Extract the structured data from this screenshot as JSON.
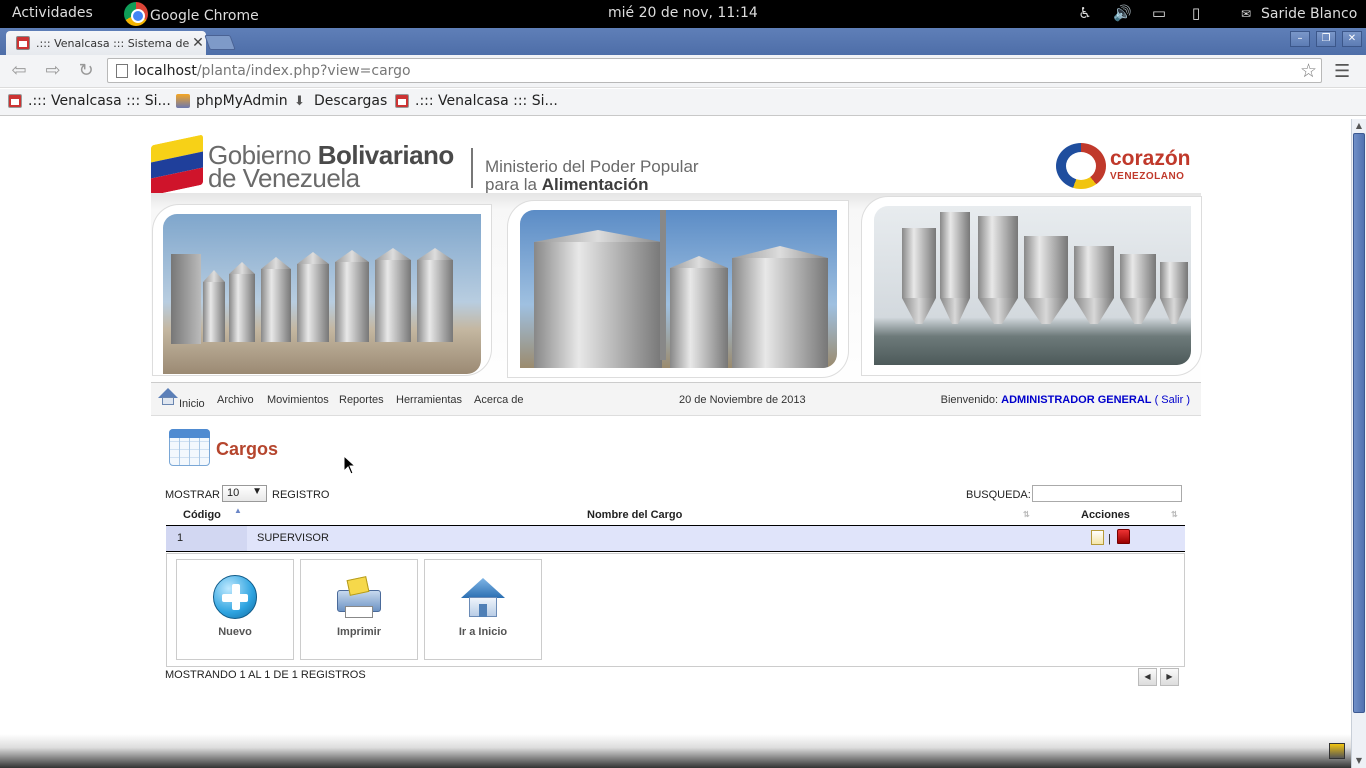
{
  "os_topbar": {
    "activities": "Actividades",
    "app_name": "Google Chrome",
    "clock": "mié 20 de nov, 11:14",
    "user": "Saride Blanco"
  },
  "browser": {
    "tab_title": ".::: Venalcasa ::: Sistema de",
    "url_host": "localhost",
    "url_path": "/planta/index.php?view=cargo",
    "bookmarks": [
      {
        "label": ".::: Venalcasa ::: Si...",
        "icon": "venalcasa-favicon"
      },
      {
        "label": "phpMyAdmin",
        "icon": "phpmyadmin-favicon"
      },
      {
        "label": "Descargas",
        "icon": "download-icon"
      },
      {
        "label": ".::: Venalcasa ::: Si...",
        "icon": "venalcasa-favicon"
      }
    ]
  },
  "banner": {
    "gob_line1": "Gobierno",
    "gob_line1_bold": "Bolivariano",
    "gob_line2": "de Venezuela",
    "min_line1": "Ministerio del Poder Popular",
    "min_line2": "para la",
    "min_line2_bold": "Alimentación",
    "corazon_1": "corazón",
    "corazon_2": "VENEZOLANO",
    "flag_colors": [
      "#f7d117",
      "#1f3f9b",
      "#cf142b"
    ]
  },
  "nav": {
    "items": [
      "Inicio",
      "Archivo",
      "Movimientos",
      "Reportes",
      "Herramientas",
      "Acerca de"
    ],
    "date": "20 de Noviembre de 2013",
    "welcome_label": "Bienvenido:",
    "user": "ADMINISTRADOR GENERAL",
    "open_paren": "(",
    "logout": "Salir",
    "close_paren": ")"
  },
  "page": {
    "title": "Cargos",
    "show_label": "MOSTRAR",
    "page_size": "10",
    "registro_label": "REGISTRO",
    "search_label": "BUSQUEDA:",
    "search_value": ""
  },
  "table": {
    "columns": [
      "Código",
      "Nombre del Cargo",
      "Acciones"
    ],
    "rows": [
      {
        "codigo": "1",
        "nombre": "SUPERVISOR"
      }
    ],
    "action_separator": "|"
  },
  "buttons": {
    "nuevo": "Nuevo",
    "imprimir": "Imprimir",
    "inicio": "Ir a Inicio"
  },
  "footer": {
    "info": "MOSTRANDO 1 AL 1 DE 1 REGISTROS"
  },
  "colors": {
    "title_accent": "#b5452d",
    "link_blue": "#0000cc",
    "row_bg": "#e0e4fa"
  }
}
